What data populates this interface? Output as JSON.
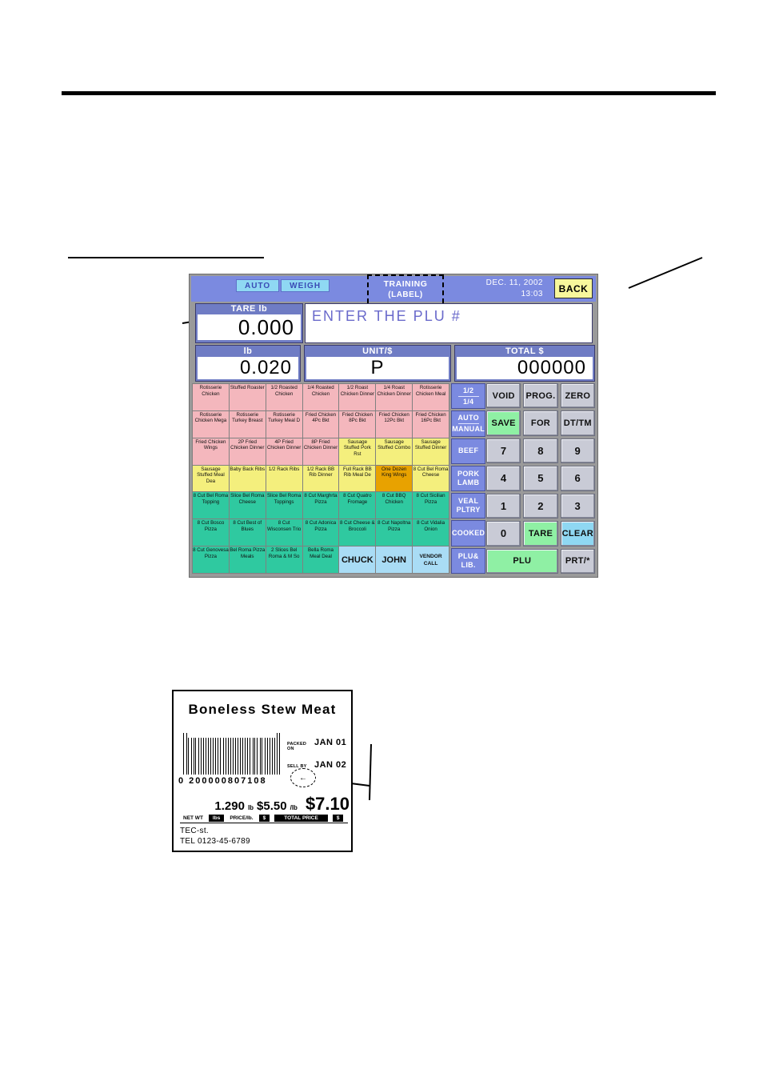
{
  "page": {
    "rules": [
      "top-rule",
      "sub-rule"
    ]
  },
  "device": {
    "statusbar": {
      "chips": [
        "AUTO",
        "WEIGH"
      ],
      "training_line1": "TRAINING",
      "training_line2": "(LABEL)",
      "date": "DEC. 11, 2002",
      "time": "13:03",
      "back_label": "BACK"
    },
    "tare": {
      "label": "TARE  lb",
      "value": "0.000"
    },
    "message": "ENTER THE PLU #",
    "totals": [
      {
        "header": "lb",
        "value": "0.020",
        "align": "right"
      },
      {
        "header": "UNIT/$",
        "value": "P",
        "align": "center"
      },
      {
        "header": "TOTAL $",
        "value": "000000",
        "align": "right"
      }
    ],
    "plu_keys": [
      {
        "text": "Rotisserie Chicken",
        "color": "pink"
      },
      {
        "text": "Stuffed Roaster",
        "color": "pink"
      },
      {
        "text": "1/2 Roasted Chicken",
        "color": "pink"
      },
      {
        "text": "1/4 Roasted Chicken",
        "color": "pink"
      },
      {
        "text": "1/2 Roast Chicken Dinner",
        "color": "pink"
      },
      {
        "text": "1/4 Roast Chicken Dinner",
        "color": "pink"
      },
      {
        "text": "Rotisserie Chicken Meal",
        "color": "pink"
      },
      {
        "text": "Rotisserie Chicken Mega",
        "color": "pink"
      },
      {
        "text": "Rotisserie Turkey Breast",
        "color": "pink"
      },
      {
        "text": "Rotisserie Turkey Meal D",
        "color": "pink"
      },
      {
        "text": "Fried Chicken 4Pc Bkt",
        "color": "pink"
      },
      {
        "text": "Fried Chicken 8Pc Bkt",
        "color": "pink"
      },
      {
        "text": "Fried Chicken 12Pc Bkt",
        "color": "pink"
      },
      {
        "text": "Fried Chicken 16Pc Bkt",
        "color": "pink"
      },
      {
        "text": "Fried Chicken Wings",
        "color": "pink"
      },
      {
        "text": "2P Fried Chicken Dinner",
        "color": "pink"
      },
      {
        "text": "4P Fried Chicken Dinner",
        "color": "pink"
      },
      {
        "text": "8P Fried Chicken Dinner",
        "color": "pink"
      },
      {
        "text": "Sausage Stuffed Pork Rst",
        "color": "yellow"
      },
      {
        "text": "Sausage Stuffed Combo",
        "color": "yellow"
      },
      {
        "text": "Sausage Stuffed Dinner",
        "color": "yellow"
      },
      {
        "text": "Sausage Stuffed Meal Dea",
        "color": "yellow"
      },
      {
        "text": "Baby Back Ribs",
        "color": "yellow"
      },
      {
        "text": "1/2 Rack Ribs",
        "color": "yellow"
      },
      {
        "text": "1/2 Rack BB Rib Dinner",
        "color": "yellow"
      },
      {
        "text": "Full Rack BB Rib Meal De",
        "color": "yellow"
      },
      {
        "text": "One Dozen King Wings",
        "color": "orange"
      },
      {
        "text": "8 Cut Bel Roma Cheese",
        "color": "yellow"
      },
      {
        "text": "8 Cut Bel Roma Topping",
        "color": "green"
      },
      {
        "text": "Slice Bel Roma Cheese",
        "color": "green"
      },
      {
        "text": "Slice Bel Roma Toppings",
        "color": "green"
      },
      {
        "text": "8 Cut Marghrta Pizza",
        "color": "green"
      },
      {
        "text": "8 Cut Quatro Fromage",
        "color": "green"
      },
      {
        "text": "8 Cut BBQ Chicken",
        "color": "green"
      },
      {
        "text": "8 Cut Sicilian Pizza",
        "color": "green"
      },
      {
        "text": "8 Cut Bosco Pizza",
        "color": "green"
      },
      {
        "text": "8 Cut Best of Blues",
        "color": "green"
      },
      {
        "text": "8 Cut Wisconsen Trio",
        "color": "green"
      },
      {
        "text": "8 Cut Adonica Pizza",
        "color": "green"
      },
      {
        "text": "8 Cut Cheese & Broccoli",
        "color": "green"
      },
      {
        "text": "8 Cut Napoltna Pizza",
        "color": "green"
      },
      {
        "text": "8 Cut Vidalia Onion",
        "color": "green"
      },
      {
        "text": "8 Cut Genovesa Pizza",
        "color": "green"
      },
      {
        "text": "Bel Roma Pizza Meals",
        "color": "green"
      },
      {
        "text": "2 Slices Bel Roma & M So",
        "color": "green"
      },
      {
        "text": "Bella Roma Meal Deal",
        "color": "green"
      },
      {
        "text": "CHUCK",
        "color": "blue"
      },
      {
        "text": "JOHN",
        "color": "blue"
      },
      {
        "text": "VENDOR CALL",
        "color": "blue-small"
      }
    ],
    "function_keys": [
      {
        "line1": "1/2",
        "line2": "1/4",
        "divider": true
      },
      {
        "line1": "AUTO",
        "line2": "MANUAL",
        "divider": true
      },
      {
        "line1": "BEEF",
        "line2": "",
        "divider": false
      },
      {
        "line1": "PORK",
        "line2": "LAMB",
        "divider": false
      },
      {
        "line1": "VEAL",
        "line2": "PLTRY",
        "divider": false
      },
      {
        "line1": "COOKED",
        "line2": "",
        "divider": false
      },
      {
        "line1": "PLU&",
        "line2": "LIB.",
        "divider": false
      }
    ],
    "keypad": [
      {
        "label": "VOID",
        "style": "gray"
      },
      {
        "label": "PROG.",
        "style": "gray"
      },
      {
        "label": "ZERO",
        "style": "gray"
      },
      {
        "label": "SAVE",
        "style": "green"
      },
      {
        "label": "FOR",
        "style": "gray"
      },
      {
        "label": "DT/TM",
        "style": "gray"
      },
      {
        "label": "7",
        "style": "num"
      },
      {
        "label": "8",
        "style": "num"
      },
      {
        "label": "9",
        "style": "num"
      },
      {
        "label": "4",
        "style": "num"
      },
      {
        "label": "5",
        "style": "num"
      },
      {
        "label": "6",
        "style": "num"
      },
      {
        "label": "1",
        "style": "num"
      },
      {
        "label": "2",
        "style": "num"
      },
      {
        "label": "3",
        "style": "num"
      },
      {
        "label": "0",
        "style": "num"
      },
      {
        "label": "TARE",
        "style": "green"
      },
      {
        "label": "CLEAR",
        "style": "cyan"
      },
      {
        "label": "PLU",
        "style": "green wide"
      },
      {
        "label": "PRT/*",
        "style": "gray"
      }
    ]
  },
  "label": {
    "product_name": "Boneless Stew Meat",
    "barcode_digits": "0  200000807108",
    "packed_on_caption": "PACKED ON",
    "packed_on_value": "JAN 01",
    "sell_by_caption": "SELL BY",
    "sell_by_value": "JAN 02",
    "circle_glyph": "←",
    "net_weight": "1.290",
    "net_weight_unit": "lb",
    "unit_price": "$5.50",
    "unit_price_suffix": "/lb",
    "total_price": "$7.10",
    "caption_net_wt": "NET WT",
    "caption_lbs": "lbs",
    "caption_price": "PRICE/lb.",
    "caption_dollar": "$",
    "caption_total": "TOTAL PRICE",
    "caption_dollar2": "$",
    "store_line1": "TEC-st.",
    "store_line2": "TEL 0123-45-6789"
  }
}
